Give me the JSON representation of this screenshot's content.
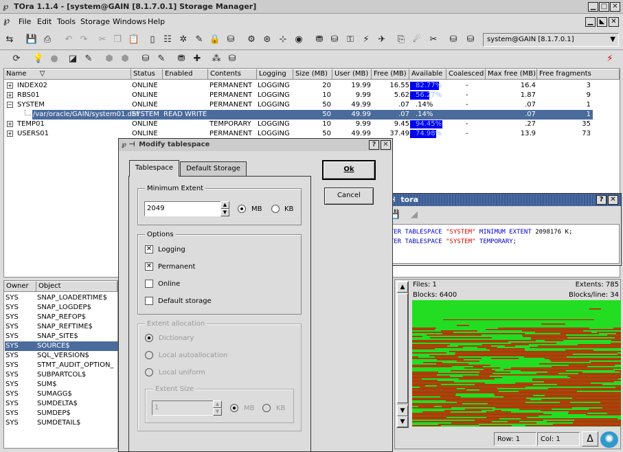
{
  "app": {
    "title": "TOra 1.1.4 - [system@GAIN [8.1.7.0.1] Storage Manager]"
  },
  "menu": [
    "File",
    "Edit",
    "Tools",
    "Storage",
    "Windows",
    "Help"
  ],
  "connection": {
    "value": "system@GAIN [8.1.7.0.1]"
  },
  "table": {
    "columns": [
      "Name",
      "Status",
      "Enabled",
      "Contents",
      "Logging",
      "Size (MB)",
      "User (MB)",
      "Free (MB)",
      "Available",
      "Coalesced",
      "Max free (MB)",
      "Free fragments"
    ],
    "rows": [
      {
        "name": "INDEX02",
        "status": "ONLINE",
        "enabled": "",
        "contents": "PERMANENT",
        "logging": "LOGGING",
        "size": "20",
        "user": "19.99",
        "free": "16.55",
        "available": "82.77%",
        "coalesced": "-",
        "maxfree": "16.4",
        "frags": "3",
        "expander": "+",
        "level": 0,
        "avail_fill": 0.83
      },
      {
        "name": "RBS01",
        "status": "ONLINE",
        "enabled": "",
        "contents": "PERMANENT",
        "logging": "LOGGING",
        "size": "10",
        "user": "9.99",
        "free": "5.62",
        "available": "56.27%",
        "coalesced": "-",
        "maxfree": "1.87",
        "frags": "9",
        "expander": "+",
        "level": 0,
        "avail_fill": 0.56
      },
      {
        "name": "SYSTEM",
        "status": "ONLINE",
        "enabled": "",
        "contents": "PERMANENT",
        "logging": "LOGGING",
        "size": "50",
        "user": "49.99",
        "free": ".07",
        "available": ".14%",
        "coalesced": "-",
        "maxfree": ".07",
        "frags": "1",
        "expander": "-",
        "level": 0,
        "avail_fill": 0.0
      },
      {
        "name": "/var/oracle/GAIN/system01.dbf",
        "status": "SYSTEM",
        "enabled": "READ WRITE",
        "contents": "",
        "logging": "",
        "size": "50",
        "user": "49.99",
        "free": ".07",
        "available": ".14%",
        "coalesced": "",
        "maxfree": ".07",
        "frags": "1",
        "expander": "",
        "level": 1,
        "selected": true,
        "avail_fill": 0.0
      },
      {
        "name": "TEMP01",
        "status": "ONLINE",
        "enabled": "",
        "contents": "TEMPORARY",
        "logging": "LOGGING",
        "size": "10",
        "user": "9.99",
        "free": "9.45",
        "available": "94.45%",
        "coalesced": "-",
        "maxfree": ".27",
        "frags": "35",
        "expander": "+",
        "level": 0,
        "avail_fill": 0.94
      },
      {
        "name": "USERS01",
        "status": "ONLINE",
        "enabled": "",
        "contents": "PERMANENT",
        "logging": "LOGGING",
        "size": "50",
        "user": "49.99",
        "free": "37.49",
        "available": "74.98%",
        "coalesced": "-",
        "maxfree": "13.9",
        "frags": "73",
        "expander": "+",
        "level": 0,
        "avail_fill": 0.75
      }
    ]
  },
  "objects": {
    "columns": [
      "Owner",
      "Object"
    ],
    "rows": [
      {
        "owner": "SYS",
        "object": "SNAP_LOADERTIME$"
      },
      {
        "owner": "SYS",
        "object": "SNAP_LOGDEP$"
      },
      {
        "owner": "SYS",
        "object": "SNAP_REFOP$"
      },
      {
        "owner": "SYS",
        "object": "SNAP_REFTIME$"
      },
      {
        "owner": "SYS",
        "object": "SNAP_SITE$"
      },
      {
        "owner": "SYS",
        "object": "SOURCE$",
        "selected": true
      },
      {
        "owner": "SYS",
        "object": "SQL_VERSION$"
      },
      {
        "owner": "SYS",
        "object": "STMT_AUDIT_OPTION_"
      },
      {
        "owner": "SYS",
        "object": "SUBPARTCOL$"
      },
      {
        "owner": "SYS",
        "object": "SUM$"
      },
      {
        "owner": "SYS",
        "object": "SUMAGG$"
      },
      {
        "owner": "SYS",
        "object": "SUMDELTA$"
      },
      {
        "owner": "SYS",
        "object": "SUMDEP$"
      },
      {
        "owner": "SYS",
        "object": "SUMDETAIL$"
      }
    ]
  },
  "dialog": {
    "title": "Modify tablespace",
    "tabs": [
      "Tablespace",
      "Default Storage"
    ],
    "min_extent": {
      "label": "Minimum Extent",
      "value": "2049",
      "mb": "MB",
      "kb": "KB"
    },
    "options": {
      "label": "Options",
      "logging": "Logging",
      "permanent": "Permanent",
      "online": "Online",
      "default_storage": "Default storage"
    },
    "extent_alloc": {
      "label": "Extent allocation",
      "dictionary": "Dictionary",
      "local_auto": "Local autoallocation",
      "local_uniform": "Local uniform",
      "size_label": "Extent Size",
      "size_value": "1",
      "mb": "MB",
      "kb": "KB"
    },
    "ok": "Ok",
    "cancel": "Cancel"
  },
  "sql_window": {
    "title": "tora",
    "lines": [
      {
        "kw1": "ALTER TABLESPACE ",
        "str": "\"SYSTEM\"",
        "kw2": " MINIMUM EXTENT ",
        "rest": "2098176 K;"
      },
      {
        "kw1": "ALTER TABLESPACE ",
        "str": "\"SYSTEM\"",
        "kw2": " TEMPORARY;",
        "rest": ""
      }
    ]
  },
  "extent_view": {
    "files": "Files: 1",
    "extents": "Extents: 785",
    "blocks": "Blocks: 6400",
    "blocks_line": "Blocks/line: 34",
    "row": "Row: 1",
    "col": "Col: 1"
  },
  "colors": {
    "selection": "#4a6b9c",
    "available_bar": "#0000f0",
    "used": "#e00000",
    "free": "#22dd22"
  }
}
